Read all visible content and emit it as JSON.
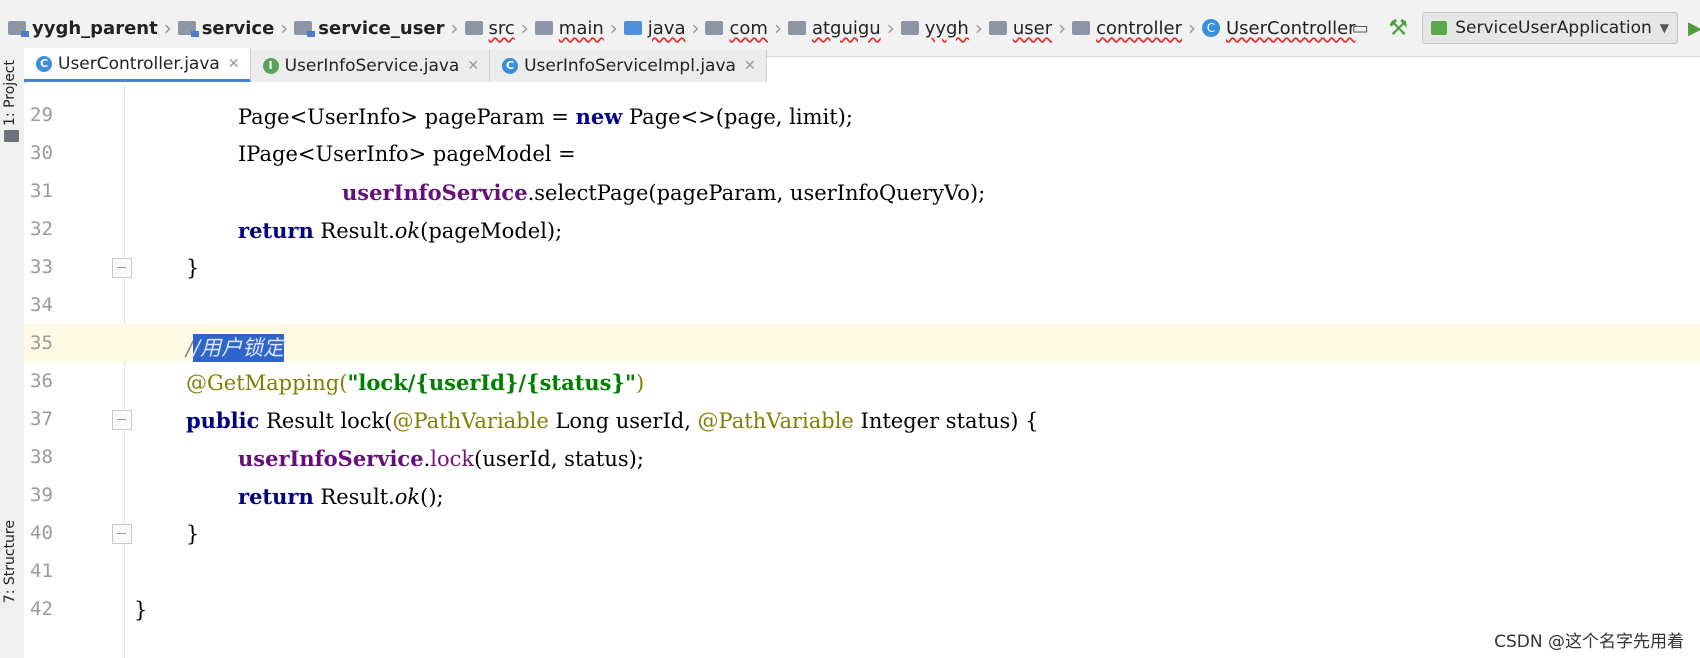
{
  "breadcrumb": {
    "items": [
      {
        "label": "yygh_parent"
      },
      {
        "label": "service"
      },
      {
        "label": "service_user"
      },
      {
        "label": "src"
      },
      {
        "label": "main"
      },
      {
        "label": "java"
      },
      {
        "label": "com"
      },
      {
        "label": "atguigu"
      },
      {
        "label": "yygh"
      },
      {
        "label": "user"
      },
      {
        "label": "controller"
      },
      {
        "label": "UserController"
      }
    ]
  },
  "toolbar": {
    "run_config": "ServiceUserApplication"
  },
  "tool_windows": {
    "project": "1: Project",
    "structure": "7: Structure"
  },
  "tabs": [
    {
      "label": "UserController.java",
      "icon": "class-icon",
      "active": true
    },
    {
      "label": "UserInfoService.java",
      "icon": "interface-icon",
      "active": false
    },
    {
      "label": "UserInfoServiceImpl.java",
      "icon": "class-icon",
      "active": false
    }
  ],
  "editor": {
    "current_line": 35,
    "lines": [
      {
        "n": "29",
        "t1": "Page<UserInfo> pageParam = ",
        "kw": "new",
        "t2": " Page<>(page, limit);"
      },
      {
        "n": "30",
        "t1": "IPage<UserInfo> pageModel ="
      },
      {
        "n": "31",
        "fld": "userInfoService",
        "t2": ".selectPage(pageParam, userInfoQueryVo);"
      },
      {
        "n": "32",
        "kw": "return",
        "t1": " Result.",
        "it": "ok",
        "t2": "(pageModel);"
      },
      {
        "n": "33",
        "t1": "}"
      },
      {
        "n": "34"
      },
      {
        "n": "35",
        "cmt_prefix": "/",
        "cmt_sel": "/用户锁定"
      },
      {
        "n": "36",
        "ann": "@GetMapping(",
        "str": "\"lock/{userId}/{status}\"",
        "ann2": ")"
      },
      {
        "n": "37",
        "kw": "public",
        "t1": " Result lock(",
        "ann": "@PathVariable",
        "t2": " Long userId, ",
        "ann2": "@PathVariable",
        "t3": " Integer status) {"
      },
      {
        "n": "38",
        "fld": "userInfoService",
        "t1": ".",
        "mcall": "lock",
        "t2": "(userId, status);"
      },
      {
        "n": "39",
        "kw": "return",
        "t1": " Result.",
        "it": "ok",
        "t2": "();"
      },
      {
        "n": "40",
        "t1": "}"
      },
      {
        "n": "41"
      },
      {
        "n": "42",
        "t1": "}"
      }
    ]
  },
  "watermark": "CSDN @这个名字先用着"
}
